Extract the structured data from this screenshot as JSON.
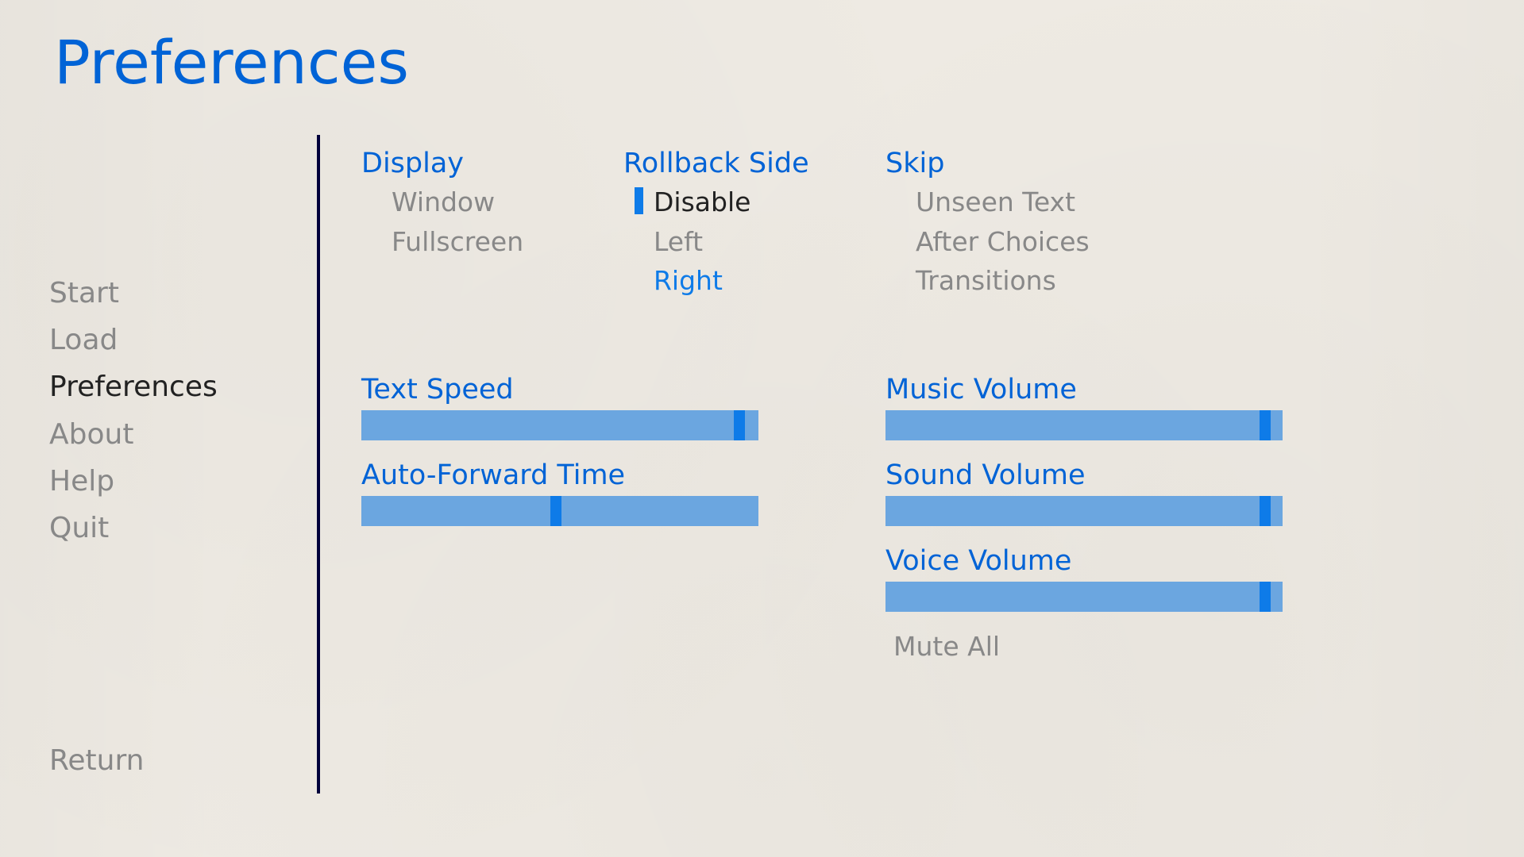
{
  "title": "Preferences",
  "nav": {
    "start": "Start",
    "load": "Load",
    "preferences": "Preferences",
    "about": "About",
    "help": "Help",
    "quit": "Quit",
    "return": "Return"
  },
  "display": {
    "heading": "Display",
    "window": "Window",
    "fullscreen": "Fullscreen"
  },
  "rollback": {
    "heading": "Rollback Side",
    "disable": "Disable",
    "left": "Left",
    "right": "Right"
  },
  "skip": {
    "heading": "Skip",
    "unseen": "Unseen Text",
    "after_choices": "After Choices",
    "transitions": "Transitions"
  },
  "sliders": {
    "text_speed": {
      "label": "Text Speed",
      "value": 0.965
    },
    "auto_forward": {
      "label": "Auto-Forward Time",
      "value": 0.49
    },
    "music_volume": {
      "label": "Music Volume",
      "value": 0.97
    },
    "sound_volume": {
      "label": "Sound Volume",
      "value": 0.97
    },
    "voice_volume": {
      "label": "Voice Volume",
      "value": 0.97
    }
  },
  "mute_all": "Mute All"
}
